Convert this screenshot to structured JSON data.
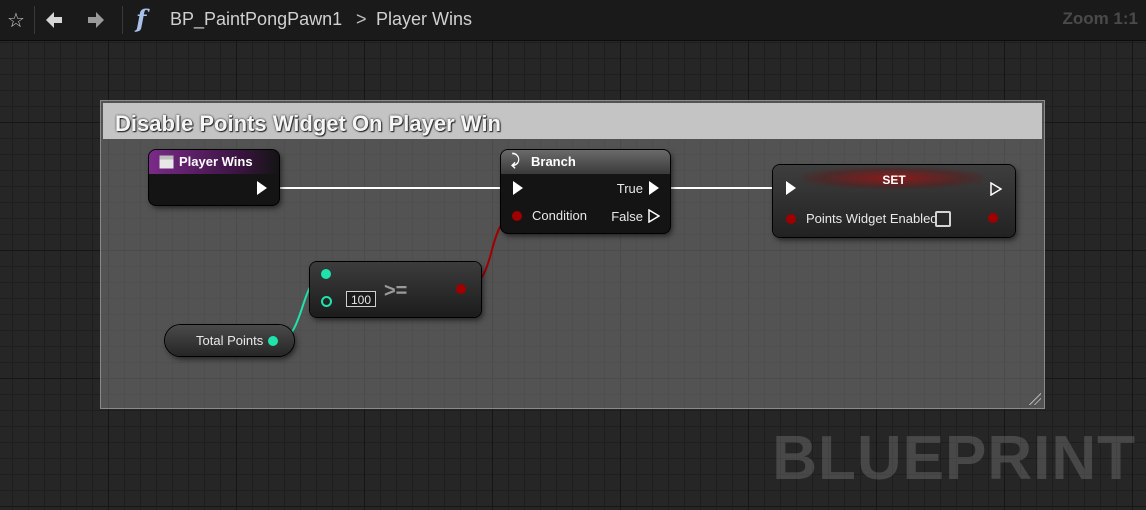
{
  "toolbar": {
    "breadcrumb_root": "BP_PaintPongPawn1",
    "breadcrumb_separator": ">",
    "breadcrumb_current": "Player Wins",
    "zoom": "Zoom 1:1",
    "icons": [
      "star-icon",
      "back-arrow-icon",
      "forward-arrow-icon",
      "function-icon"
    ]
  },
  "comment": {
    "title": "Disable Points Widget On Player Win"
  },
  "nodes": {
    "player_wins": {
      "title": "Player Wins",
      "header_color": "#7a2a88"
    },
    "branch": {
      "title": "Branch",
      "condition_label": "Condition",
      "true_label": "True",
      "false_label": "False"
    },
    "compare": {
      "operator": ">=",
      "literal": "100"
    },
    "total_points": {
      "title": "Total Points"
    },
    "set": {
      "title": "SET",
      "var_label": "Points Widget Enabled"
    }
  },
  "colors": {
    "exec_wire": "#ffffff",
    "bool_pin": "#a00000",
    "int_pin": "#1fe3ad",
    "set_header": "#7a1b1b"
  },
  "watermark": "BLUEPRINT"
}
